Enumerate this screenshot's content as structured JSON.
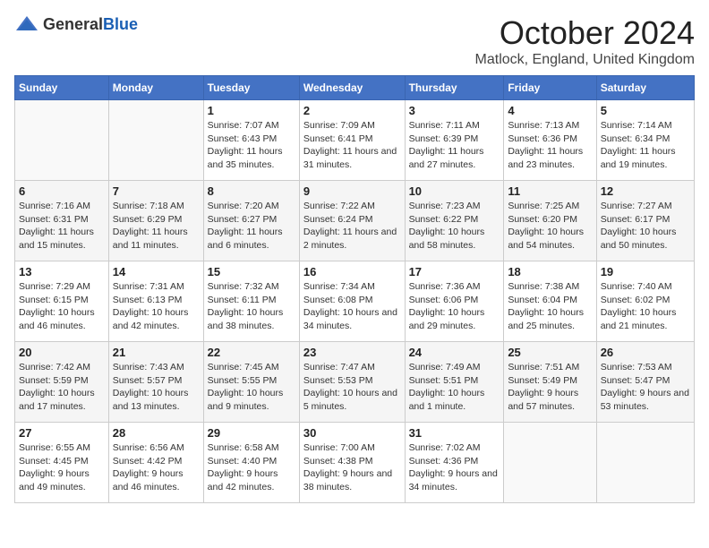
{
  "header": {
    "logo_general": "General",
    "logo_blue": "Blue",
    "month_title": "October 2024",
    "location": "Matlock, England, United Kingdom"
  },
  "days_of_week": [
    "Sunday",
    "Monday",
    "Tuesday",
    "Wednesday",
    "Thursday",
    "Friday",
    "Saturday"
  ],
  "weeks": [
    [
      {
        "day": "",
        "content": ""
      },
      {
        "day": "",
        "content": ""
      },
      {
        "day": "1",
        "content": "Sunrise: 7:07 AM\nSunset: 6:43 PM\nDaylight: 11 hours and 35 minutes."
      },
      {
        "day": "2",
        "content": "Sunrise: 7:09 AM\nSunset: 6:41 PM\nDaylight: 11 hours and 31 minutes."
      },
      {
        "day": "3",
        "content": "Sunrise: 7:11 AM\nSunset: 6:39 PM\nDaylight: 11 hours and 27 minutes."
      },
      {
        "day": "4",
        "content": "Sunrise: 7:13 AM\nSunset: 6:36 PM\nDaylight: 11 hours and 23 minutes."
      },
      {
        "day": "5",
        "content": "Sunrise: 7:14 AM\nSunset: 6:34 PM\nDaylight: 11 hours and 19 minutes."
      }
    ],
    [
      {
        "day": "6",
        "content": "Sunrise: 7:16 AM\nSunset: 6:31 PM\nDaylight: 11 hours and 15 minutes."
      },
      {
        "day": "7",
        "content": "Sunrise: 7:18 AM\nSunset: 6:29 PM\nDaylight: 11 hours and 11 minutes."
      },
      {
        "day": "8",
        "content": "Sunrise: 7:20 AM\nSunset: 6:27 PM\nDaylight: 11 hours and 6 minutes."
      },
      {
        "day": "9",
        "content": "Sunrise: 7:22 AM\nSunset: 6:24 PM\nDaylight: 11 hours and 2 minutes."
      },
      {
        "day": "10",
        "content": "Sunrise: 7:23 AM\nSunset: 6:22 PM\nDaylight: 10 hours and 58 minutes."
      },
      {
        "day": "11",
        "content": "Sunrise: 7:25 AM\nSunset: 6:20 PM\nDaylight: 10 hours and 54 minutes."
      },
      {
        "day": "12",
        "content": "Sunrise: 7:27 AM\nSunset: 6:17 PM\nDaylight: 10 hours and 50 minutes."
      }
    ],
    [
      {
        "day": "13",
        "content": "Sunrise: 7:29 AM\nSunset: 6:15 PM\nDaylight: 10 hours and 46 minutes."
      },
      {
        "day": "14",
        "content": "Sunrise: 7:31 AM\nSunset: 6:13 PM\nDaylight: 10 hours and 42 minutes."
      },
      {
        "day": "15",
        "content": "Sunrise: 7:32 AM\nSunset: 6:11 PM\nDaylight: 10 hours and 38 minutes."
      },
      {
        "day": "16",
        "content": "Sunrise: 7:34 AM\nSunset: 6:08 PM\nDaylight: 10 hours and 34 minutes."
      },
      {
        "day": "17",
        "content": "Sunrise: 7:36 AM\nSunset: 6:06 PM\nDaylight: 10 hours and 29 minutes."
      },
      {
        "day": "18",
        "content": "Sunrise: 7:38 AM\nSunset: 6:04 PM\nDaylight: 10 hours and 25 minutes."
      },
      {
        "day": "19",
        "content": "Sunrise: 7:40 AM\nSunset: 6:02 PM\nDaylight: 10 hours and 21 minutes."
      }
    ],
    [
      {
        "day": "20",
        "content": "Sunrise: 7:42 AM\nSunset: 5:59 PM\nDaylight: 10 hours and 17 minutes."
      },
      {
        "day": "21",
        "content": "Sunrise: 7:43 AM\nSunset: 5:57 PM\nDaylight: 10 hours and 13 minutes."
      },
      {
        "day": "22",
        "content": "Sunrise: 7:45 AM\nSunset: 5:55 PM\nDaylight: 10 hours and 9 minutes."
      },
      {
        "day": "23",
        "content": "Sunrise: 7:47 AM\nSunset: 5:53 PM\nDaylight: 10 hours and 5 minutes."
      },
      {
        "day": "24",
        "content": "Sunrise: 7:49 AM\nSunset: 5:51 PM\nDaylight: 10 hours and 1 minute."
      },
      {
        "day": "25",
        "content": "Sunrise: 7:51 AM\nSunset: 5:49 PM\nDaylight: 9 hours and 57 minutes."
      },
      {
        "day": "26",
        "content": "Sunrise: 7:53 AM\nSunset: 5:47 PM\nDaylight: 9 hours and 53 minutes."
      }
    ],
    [
      {
        "day": "27",
        "content": "Sunrise: 6:55 AM\nSunset: 4:45 PM\nDaylight: 9 hours and 49 minutes."
      },
      {
        "day": "28",
        "content": "Sunrise: 6:56 AM\nSunset: 4:42 PM\nDaylight: 9 hours and 46 minutes."
      },
      {
        "day": "29",
        "content": "Sunrise: 6:58 AM\nSunset: 4:40 PM\nDaylight: 9 hours and 42 minutes."
      },
      {
        "day": "30",
        "content": "Sunrise: 7:00 AM\nSunset: 4:38 PM\nDaylight: 9 hours and 38 minutes."
      },
      {
        "day": "31",
        "content": "Sunrise: 7:02 AM\nSunset: 4:36 PM\nDaylight: 9 hours and 34 minutes."
      },
      {
        "day": "",
        "content": ""
      },
      {
        "day": "",
        "content": ""
      }
    ]
  ]
}
